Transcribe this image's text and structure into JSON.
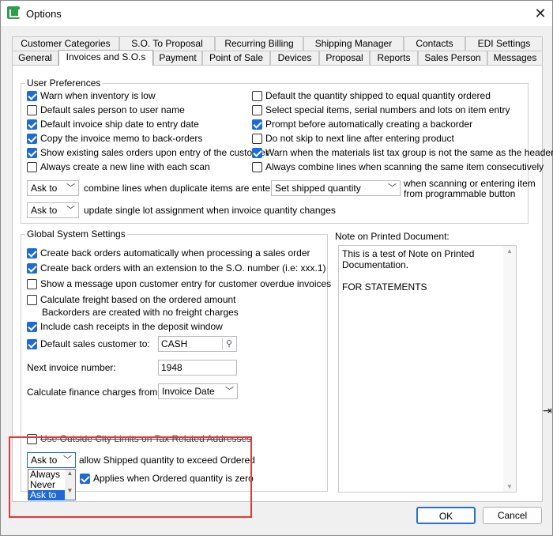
{
  "window": {
    "title": "Options",
    "close_glyph": "✕"
  },
  "tabs_row1": [
    "Customer Categories",
    "S.O. To Proposal",
    "Recurring Billing",
    "Shipping Manager",
    "Contacts",
    "EDI Settings"
  ],
  "tabs_row2": [
    "General",
    "Invoices and S.O.s",
    "Payment",
    "Point of Sale",
    "Devices",
    "Proposal",
    "Reports",
    "Sales Person",
    "Messages"
  ],
  "active_tab": "Invoices and S.O.s",
  "user_prefs": {
    "title": "User Preferences",
    "left": [
      {
        "label": "Warn when inventory is low",
        "checked": true
      },
      {
        "label": "Default sales person to user name",
        "checked": false
      },
      {
        "label": "Default invoice ship date to entry date",
        "checked": true
      },
      {
        "label": "Copy the invoice memo to back-orders",
        "checked": true
      },
      {
        "label": "Show existing sales orders upon entry of the customer",
        "checked": true
      },
      {
        "label": "Always create a new line with each scan",
        "checked": false
      }
    ],
    "right": [
      {
        "label": "Default the quantity shipped to equal quantity ordered",
        "checked": false
      },
      {
        "label": "Select special items, serial numbers and lots on item entry",
        "checked": false
      },
      {
        "label": "Prompt before automatically creating a backorder",
        "checked": true
      },
      {
        "label": "Do not skip to next line after entering product",
        "checked": false
      },
      {
        "label": "Warn when the materials list tax group is not the same as the header",
        "checked": true
      },
      {
        "label": "Always combine lines when scanning the same item consecutively",
        "checked": false
      }
    ],
    "combine_select": "Ask to",
    "combine_text": "combine lines when duplicate items are entered.",
    "shipped_select": "Set shipped quantity",
    "shipped_text_1": "when scanning or entering item",
    "shipped_text_2": "from programmable button",
    "lot_select": "Ask to",
    "lot_text": "update single lot assignment when invoice quantity changes"
  },
  "global": {
    "title": "Global System Settings",
    "items": [
      {
        "label": "Create back orders automatically when processing a sales order",
        "checked": true
      },
      {
        "label": "Create back orders with an extension to the S.O. number (i.e: xxx.1)",
        "checked": true
      },
      {
        "label": "Show a message upon customer entry for customer overdue invoices",
        "checked": false
      },
      {
        "label": "Calculate freight based on the ordered amount",
        "checked": false
      },
      {
        "label": "Include cash receipts in the deposit window",
        "checked": true
      },
      {
        "label": "Default sales customer to:",
        "checked": true
      }
    ],
    "freight_note": "Backorders are created with no freight charges",
    "customer_value": "CASH",
    "next_invoice_label": "Next invoice number:",
    "next_invoice_value": "1948",
    "finance_label": "Calculate finance charges from the",
    "finance_value": "Invoice Date",
    "city_limits": {
      "label": "Use Outside City Limits on Tax Related Addresses",
      "checked": false
    },
    "shipped_exceed_select": "Ask to",
    "shipped_exceed_text": "allow Shipped quantity to exceed Ordered",
    "applies": {
      "label": "Applies when Ordered quantity is zero",
      "checked": true
    },
    "dropdown_options": [
      "Always",
      "Never",
      "Ask to"
    ],
    "dropdown_selected": "Ask to"
  },
  "note": {
    "label": "Note on Printed Document:",
    "line1": "This is a test of Note on Printed",
    "line2": "Documentation.",
    "line3": "FOR STATEMENTS"
  },
  "buttons": {
    "ok": "OK",
    "cancel": "Cancel"
  }
}
